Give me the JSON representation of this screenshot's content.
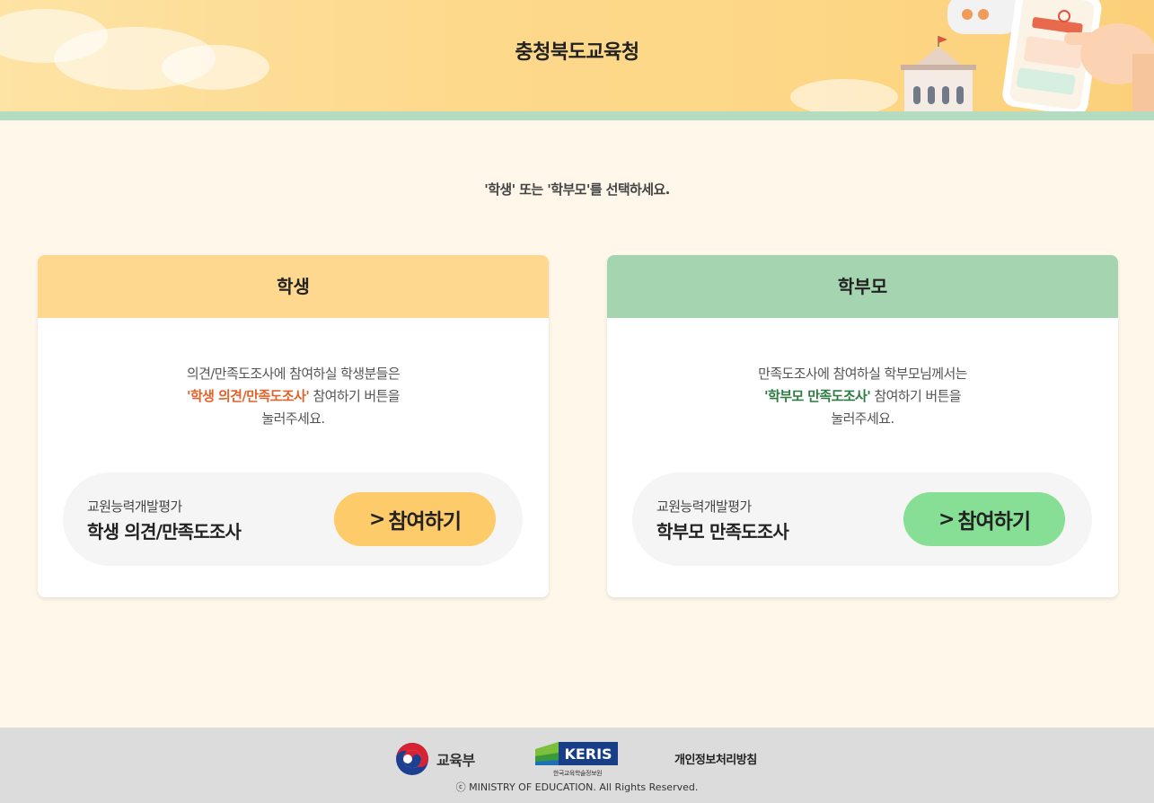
{
  "header": {
    "title": "충청북도교육청"
  },
  "instruction": "'학생' 또는 '학부모'를 선택하세요.",
  "cards": [
    {
      "heading": "학생",
      "desc_line1": "의견/만족도조사에 참여하실 학생분들은",
      "desc_highlight": "'학생 의견/만족도조사'",
      "desc_line2_rest": " 참여하기 버튼을",
      "desc_line3": "눌러주세요.",
      "action_sub": "교원능력개발평가",
      "action_title": "학생 의견/만족도조사",
      "button_label": "참여하기",
      "button_icon": "chevron-right-icon",
      "accent_color": "#fed88f",
      "button_color": "#fecb6a"
    },
    {
      "heading": "학부모",
      "desc_line1": "만족도조사에 참여하실 학부모님께서는",
      "desc_highlight": "'학부모 만족도조사'",
      "desc_line2_rest": " 참여하기 버튼을",
      "desc_line3": "눌러주세요.",
      "action_sub": "교원능력개발평가",
      "action_title": "학부모 만족도조사",
      "button_label": "참여하기",
      "button_icon": "chevron-right-icon",
      "accent_color": "#a5d5b0",
      "button_color": "#87df95"
    }
  ],
  "footer": {
    "moe_name": "교육부",
    "keris_name": "KERIS",
    "keris_sub": "한국교육학술정보원",
    "privacy_label": "개인정보처리방침",
    "copyright": "ⓒ MINISTRY OF EDUCATION. All Rights Reserved."
  }
}
